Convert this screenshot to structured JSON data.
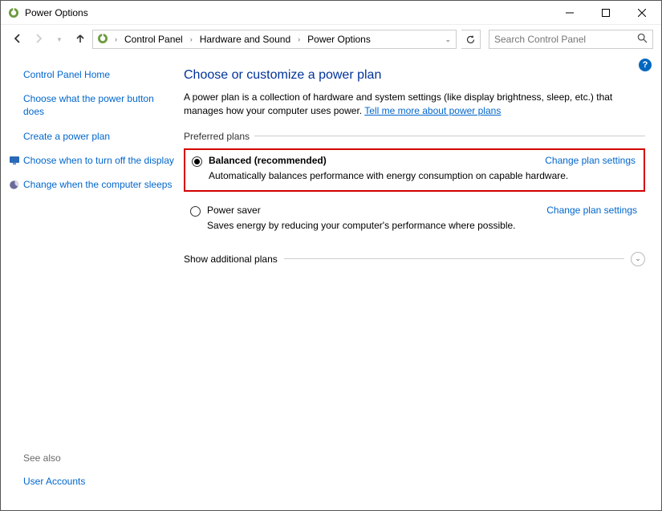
{
  "window": {
    "title": "Power Options"
  },
  "breadcrumb": {
    "items": [
      "Control Panel",
      "Hardware and Sound",
      "Power Options"
    ]
  },
  "search": {
    "placeholder": "Search Control Panel"
  },
  "sidebar": {
    "home": "Control Panel Home",
    "links": [
      "Choose what the power button does",
      "Create a power plan",
      "Choose when to turn off the display",
      "Change when the computer sleeps"
    ],
    "see_also_label": "See also",
    "see_also_links": [
      "User Accounts"
    ]
  },
  "content": {
    "heading": "Choose or customize a power plan",
    "description_pre": "A power plan is a collection of hardware and system settings (like display brightness, sleep, etc.) that manages how your computer uses power. ",
    "description_link": "Tell me more about power plans",
    "preferred_label": "Preferred plans",
    "plans": [
      {
        "name": "Balanced (recommended)",
        "desc": "Automatically balances performance with energy consumption on capable hardware.",
        "selected": true,
        "highlighted": true,
        "change_link": "Change plan settings"
      },
      {
        "name": "Power saver",
        "desc": "Saves energy by reducing your computer's performance where possible.",
        "selected": false,
        "highlighted": false,
        "change_link": "Change plan settings"
      }
    ],
    "show_additional": "Show additional plans"
  }
}
